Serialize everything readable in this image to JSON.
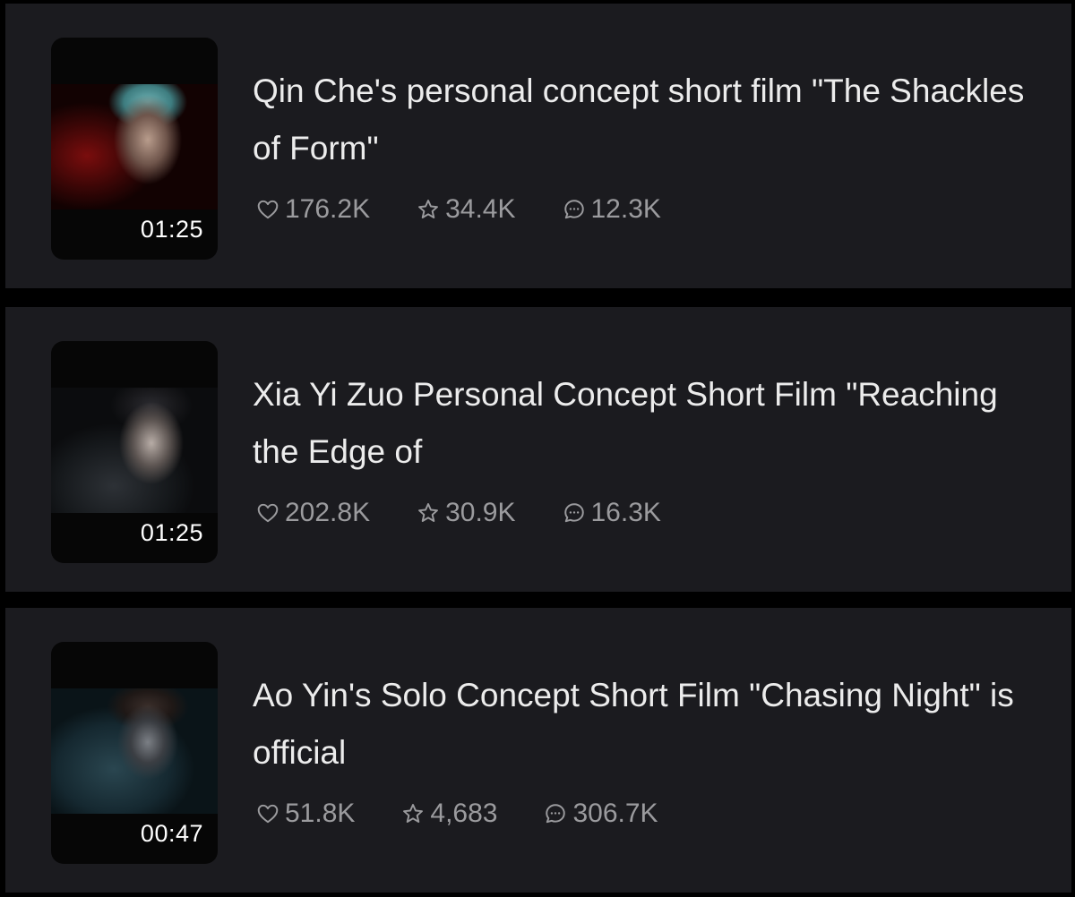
{
  "videos": [
    {
      "title": "Qin Che's personal concept short film \"The Shackles of Form\"",
      "duration": "01:25",
      "likes": "176.2K",
      "favorites": "34.4K",
      "comments": "12.3K"
    },
    {
      "title": "Xia Yi Zuo Personal Concept Short Film \"Reaching the Edge of",
      "duration": "01:25",
      "likes": "202.8K",
      "favorites": "30.9K",
      "comments": "16.3K"
    },
    {
      "title": "Ao Yin's Solo Concept Short Film \"Chasing Night\" is official",
      "duration": "00:47",
      "likes": "51.8K",
      "favorites": "4,683",
      "comments": "306.7K"
    }
  ],
  "icons": {
    "like": "heart-icon",
    "favorite": "star-icon",
    "comment": "comment-icon"
  },
  "colors": {
    "background": "#000000",
    "card": "#1b1b1f",
    "title_text": "#ececec",
    "stat_text": "#9b9b9e"
  }
}
